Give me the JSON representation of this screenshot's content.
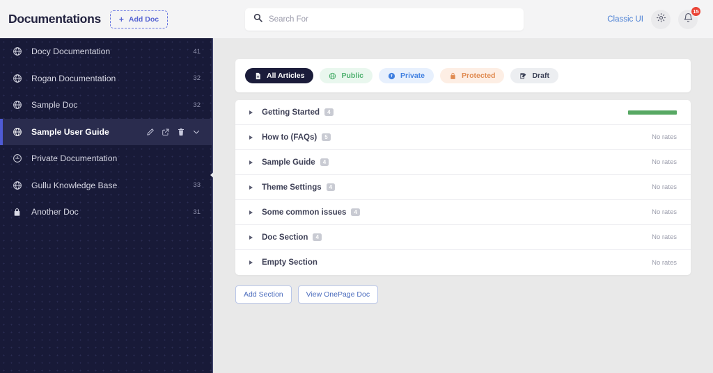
{
  "header": {
    "brand_title": "Documentations",
    "add_doc_label": "Add Doc",
    "add_doc_plus": "+",
    "classic_ui_label": "Classic UI",
    "notification_count": "15"
  },
  "search": {
    "placeholder": "Search For",
    "value": ""
  },
  "sidebar": {
    "items": [
      {
        "label": "Docy Documentation",
        "count": "41",
        "icon": "globe-icon",
        "active": false
      },
      {
        "label": "Rogan Documentation",
        "count": "32",
        "icon": "globe-icon",
        "active": false
      },
      {
        "label": "Sample Doc",
        "count": "32",
        "icon": "globe-icon",
        "active": false
      },
      {
        "label": "Sample User Guide",
        "count": "",
        "icon": "globe-icon",
        "active": true
      },
      {
        "label": "Private Documentation",
        "count": "",
        "icon": "eye-off-icon",
        "active": false
      },
      {
        "label": "Gullu Knowledge Base",
        "count": "33",
        "icon": "globe-icon",
        "active": false
      },
      {
        "label": "Another Doc",
        "count": "31",
        "icon": "lock-icon",
        "active": false
      }
    ],
    "actions": [
      "edit-icon",
      "external-link-icon",
      "trash-icon",
      "chevron-down-icon"
    ]
  },
  "filters": [
    {
      "label": "All Articles",
      "icon": "document-icon",
      "style": "all",
      "active": true
    },
    {
      "label": "Public",
      "icon": "globe-icon",
      "style": "public",
      "active": false
    },
    {
      "label": "Private",
      "icon": "shield-icon",
      "style": "private",
      "active": false
    },
    {
      "label": "Protected",
      "icon": "lock-icon",
      "style": "protected",
      "active": false
    },
    {
      "label": "Draft",
      "icon": "draft-icon",
      "style": "draft",
      "active": false
    }
  ],
  "sections": [
    {
      "name": "Getting Started",
      "badge": "4",
      "rating": "bar",
      "rating_text": ""
    },
    {
      "name": "How to (FAQs)",
      "badge": "5",
      "rating": "none",
      "rating_text": "No rates"
    },
    {
      "name": "Sample Guide",
      "badge": "4",
      "rating": "none",
      "rating_text": "No rates"
    },
    {
      "name": "Theme Settings",
      "badge": "4",
      "rating": "none",
      "rating_text": "No rates"
    },
    {
      "name": "Some common issues",
      "badge": "4",
      "rating": "none",
      "rating_text": "No rates"
    },
    {
      "name": "Doc Section",
      "badge": "4",
      "rating": "none",
      "rating_text": "No rates"
    },
    {
      "name": "Empty Section",
      "badge": "",
      "rating": "none",
      "rating_text": "No rates"
    }
  ],
  "buttons": {
    "add_section": "Add Section",
    "view_onepage": "View OnePage Doc"
  },
  "colors": {
    "sidebar_bg": "#181a38",
    "accent": "#4f5bd5",
    "rate_green": "#57a863",
    "badge_red": "#ea4335"
  }
}
